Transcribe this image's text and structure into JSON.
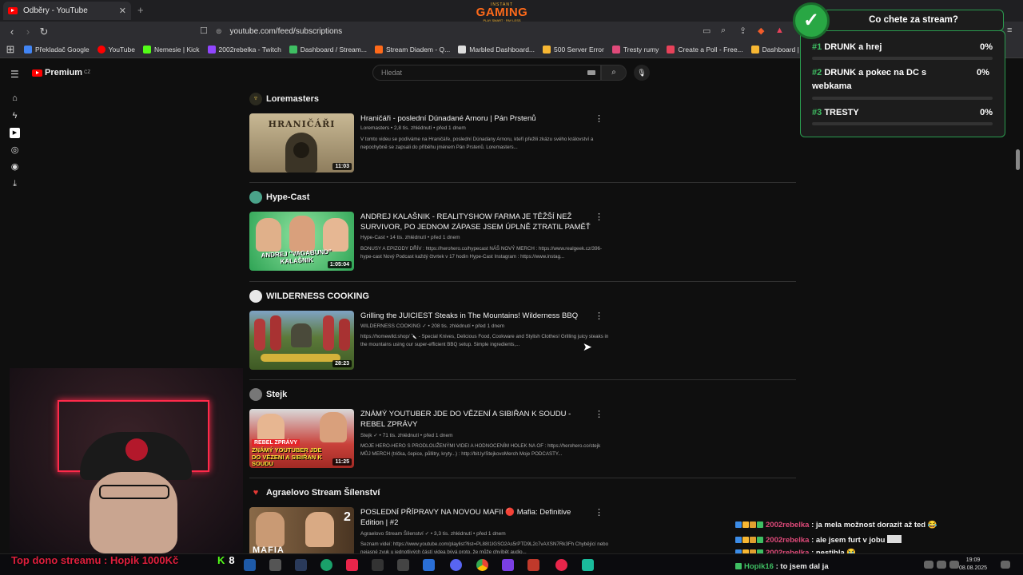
{
  "browser": {
    "tab_title": "Odběry - YouTube",
    "tab_close": "✕",
    "new_tab": "+",
    "url": "youtube.com/feed/subscriptions",
    "bookmarks": [
      {
        "label": "Překladač Google",
        "color": "#4285f4"
      },
      {
        "label": "YouTube",
        "color": "#ff0000"
      },
      {
        "label": "Nemesie | Kick",
        "color": "#53fc18"
      },
      {
        "label": "2002rebelka - Twitch",
        "color": "#9146ff"
      },
      {
        "label": "Dashboard / Stream...",
        "color": "#3fbf63"
      },
      {
        "label": "Stream Diadem - Q...",
        "color": "#ff6a1a"
      },
      {
        "label": "Marbled Dashboard...",
        "color": "#dddddd"
      },
      {
        "label": "500 Server Error",
        "color": "#f7b733"
      },
      {
        "label": "Tresty rumy",
        "color": "#e04a7a"
      },
      {
        "label": "Create a Poll - Free...",
        "color": "#e8425a"
      },
      {
        "label": "Dashboard | Adlab",
        "color": "#f7b733"
      }
    ]
  },
  "overlay": {
    "logo_top": "INSTANT",
    "logo_main": "GAMING",
    "logo_bottom": "PLAY SMART · PAY LESS"
  },
  "youtube": {
    "logo_text": "Premium",
    "logo_sup": "CZ",
    "search_placeholder": "Hledat",
    "sections": [
      {
        "channel": "Loremasters",
        "avatar_color": "#2b2a1f",
        "title": "Hraničáři - poslední Dúnadané Arnoru | Pán Prstenů",
        "meta": "Loremasters • 2,8 tis. zhlédnutí • před 1 dnem",
        "desc": "V tomto videu se podíváme na Hraničáře, poslední Dúnadany Arnoru, kteří přežili zkázu svého království a nepochybně se zapsali do příběhu jménem Pán Prstenů. Loremasters...",
        "duration": "11:03",
        "thumb_text": "HRANIČÁŘI",
        "thumb_bg": "#b8a88a"
      },
      {
        "channel": "Hype-Cast",
        "avatar_color": "#4aa38a",
        "title": "ANDREJ KALAŠNIK - REALITYSHOW FARMA JE TĚŽŠÍ NEŽ SURVIVOR, PO JEDNOM ZÁPASE JSEM ÚPLNĚ ZTRATIL PAMĚŤ",
        "meta": "Hype-Cast • 14 tis. zhlédnutí • před 1 dnem",
        "desc": "BONUSY A EPIZODY DŘÍV : https://herohero.co/hypecast NÁŠ NOVÝ MERCH : https://www.realgeek.cz/396-hype-cast Nový Podcast každý čtvrtek v 17 hodin Hype-Cast Instagram : https://www.instag...",
        "duration": "1:05:04",
        "thumb_text": "ANDREJ \"VAGABUND\" KALAŠNIK",
        "thumb_bg": "#3fc46a"
      },
      {
        "channel": "WILDERNESS COOKING",
        "avatar_color": "#e8e8e8",
        "title": "Grilling the JUICIEST Steaks in The Mountains! Wilderness BBQ",
        "meta": "WILDERNESS COOKING ✓ • 208 tis. zhlédnutí • před 1 dnem",
        "desc": "https://homewild.shop/ 🔪 - Special Knives, Delicious Food, Cookware and Stylish Clothes! Grilling juicy steaks in the mountains using our super-efficient BBQ setup. Simple ingredients,...",
        "duration": "28:23",
        "thumb_text": "",
        "thumb_bg": "#5c7a3a"
      },
      {
        "channel": "Stejk",
        "avatar_color": "#777777",
        "title": "ZNÁMÝ YOUTUBER JDE DO VĚZENÍ A SIBIŘAN K SOUDU - REBEL ZPRÁVY",
        "meta": "Stejk ✓ • 71 tis. zhlédnutí • před 1 dnem",
        "desc": "MOJE HERO-HERO S PRODLOUŽENÝMI VIDEI A HODNOCENÍM HOLEK NA OF : https://herohero.co/stejk MŮJ MERCH (trička, čepice, půllitry, kryty...) : http://bit.ly/StejkovoMerch Moje PODCASTY...",
        "duration": "11:25",
        "thumb_text": "ZNÁMÝ YOUTUBER JDE DO VĚZENÍ A SIBIŘAN K SOUDU",
        "thumb_tag": "REBEL ZPRÁVY",
        "thumb_bg": "#c9413a"
      },
      {
        "channel": "Agraelovo Stream Šílenství",
        "avatar_color": "#c62828",
        "title": "POSLEDNÍ PŘÍPRAVY NA NOVOU MAFII 🔴 Mafia: Definitive Edition | #2",
        "meta": "Agraelovo Stream Šílenství ✓ • 3,3 tis. zhlédnutí • před 1 dnem",
        "desc": "Seznam videí: https://www.youtube.com/playlist?list=PL88I1IGSO2As5rPTD9L2c7vAXSN7Rk3Fh Chybějící nebo nejasné zvuk u jednotlivých částí videa bývá proto, že může chvíbět audio...",
        "duration": "",
        "thumb_text": "MAFIA",
        "thumb_bg": "#6b4a2e"
      }
    ]
  },
  "poll": {
    "question": "Co chete za stream?",
    "check": "✓",
    "options": [
      {
        "num": "#1",
        "label": "DRUNK a hrej",
        "pct": "0%"
      },
      {
        "num": "#2",
        "label": "DRUNK a pokec na DC s webkama",
        "pct": "0%"
      },
      {
        "num": "#3",
        "label": "TRESTY",
        "pct": "0%"
      }
    ]
  },
  "chat": [
    {
      "user": "2002rebelka",
      "msg": ": ja mela možnost dorazit až ted 😂",
      "user_color": "#e04a7a"
    },
    {
      "user": "2002rebelka",
      "msg": ": ale jsem furt v jobu",
      "user_color": "#e04a7a"
    },
    {
      "user": "2002rebelka",
      "msg": ": nestihla 😭",
      "user_color": "#e04a7a"
    },
    {
      "user": "Hopik16",
      "msg": ": to jsem dal ja",
      "user_color": "#3fbf63"
    }
  ],
  "stream": {
    "top_dono": "Top dono streamu : Hopik 1000Kč",
    "kick_count": "8"
  },
  "clock": {
    "time": "19:09",
    "date": "08.08.2025"
  }
}
